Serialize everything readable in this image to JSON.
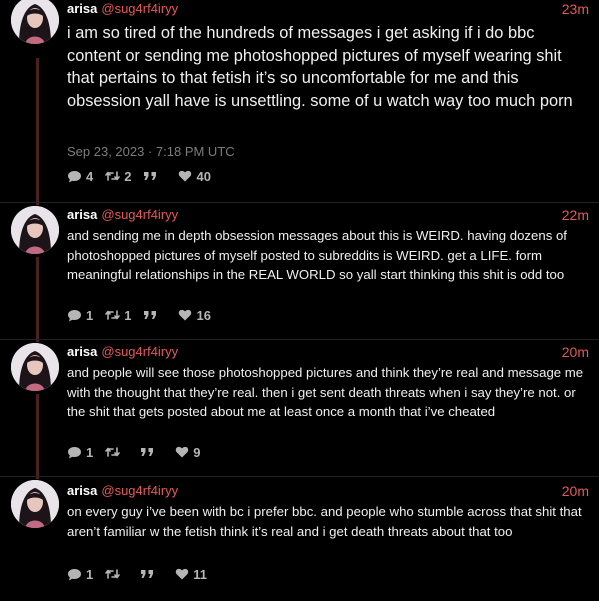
{
  "tweets": [
    {
      "name": "arisa",
      "handle": "@sug4rf4iryy",
      "time_ago": "23m",
      "text": "i am so tired of the hundreds of messages i get asking if i do bbc content or sending me photoshopped pictures of myself wearing shit that pertains to that fetish it’s so uncomfortable for me and this obsession yall have is unsettling. some of u watch way too much porn",
      "date": "Sep 23, 2023 · 7:18 PM UTC",
      "replies": "4",
      "retweets": "2",
      "quotes": "",
      "likes": "40"
    },
    {
      "name": "arisa",
      "handle": "@sug4rf4iryy",
      "time_ago": "22m",
      "text": "and sending me in depth obsession messages about this is WEIRD. having dozens of photoshopped pictures of myself posted to subreddits is WEIRD. get a LIFE. form meaningful relationships in the REAL WORLD so yall start thinking this shit is odd too",
      "replies": "1",
      "retweets": "1",
      "quotes": "",
      "likes": "16"
    },
    {
      "name": "arisa",
      "handle": "@sug4rf4iryy",
      "time_ago": "20m",
      "text": "and people will see those photoshopped pictures and think they’re real and message me with the thought that they’re real. then i get sent death threats when i say they’re not. or the shit that gets posted about me at least once a month that i’ve cheated",
      "replies": "1",
      "retweets": "",
      "quotes": "",
      "likes": "9"
    },
    {
      "name": "arisa",
      "handle": "@sug4rf4iryy",
      "time_ago": "20m",
      "text": "on every guy i’ve been with bc i prefer bbc. and people who stumble across that shit that aren’t familiar w the fetish think it’s real and i get death threats about that too",
      "replies": "1",
      "retweets": "",
      "quotes": "",
      "likes": "11"
    }
  ],
  "icons": {
    "reply": "comment-icon",
    "retweet": "retweet-icon",
    "quote": "quote-icon",
    "like": "heart-icon",
    "avatar": "profile-photo"
  },
  "colors": {
    "background": "#000000",
    "accent": "#e35a5a",
    "thread_line": "#4a2121",
    "text": "#f0f0f0",
    "muted": "#7d7d7d"
  }
}
